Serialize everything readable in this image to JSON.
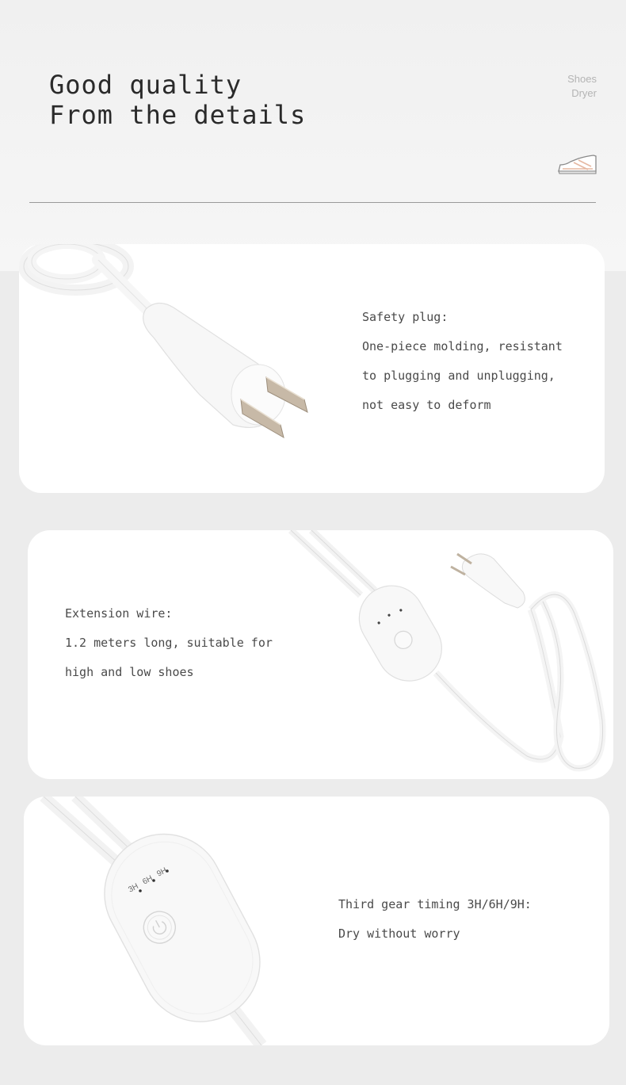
{
  "header": {
    "headline_line1": "Good quality",
    "headline_line2": "From the details",
    "brand_line1": "Shoes",
    "brand_line2": "Dryer",
    "icon": "sneaker-icon"
  },
  "features": [
    {
      "title": "Safety plug:",
      "lines": [
        "One-piece molding, resistant",
        "to plugging and unplugging,",
        "not easy to deform"
      ],
      "image": "plug-photo"
    },
    {
      "title": "Extension wire:",
      "lines": [
        "1.2 meters long, suitable for",
        "high and low shoes"
      ],
      "image": "cord-photo"
    },
    {
      "title": "Third gear timing 3H/6H/9H:",
      "lines": [
        "Dry without worry"
      ],
      "image": "controller-photo",
      "timer_labels": [
        "3H",
        "6H",
        "9H"
      ]
    }
  ],
  "colors": {
    "background": "#efefef",
    "card": "#ffffff",
    "text": "#4a4a4a",
    "accent": "#e6b8a2"
  }
}
